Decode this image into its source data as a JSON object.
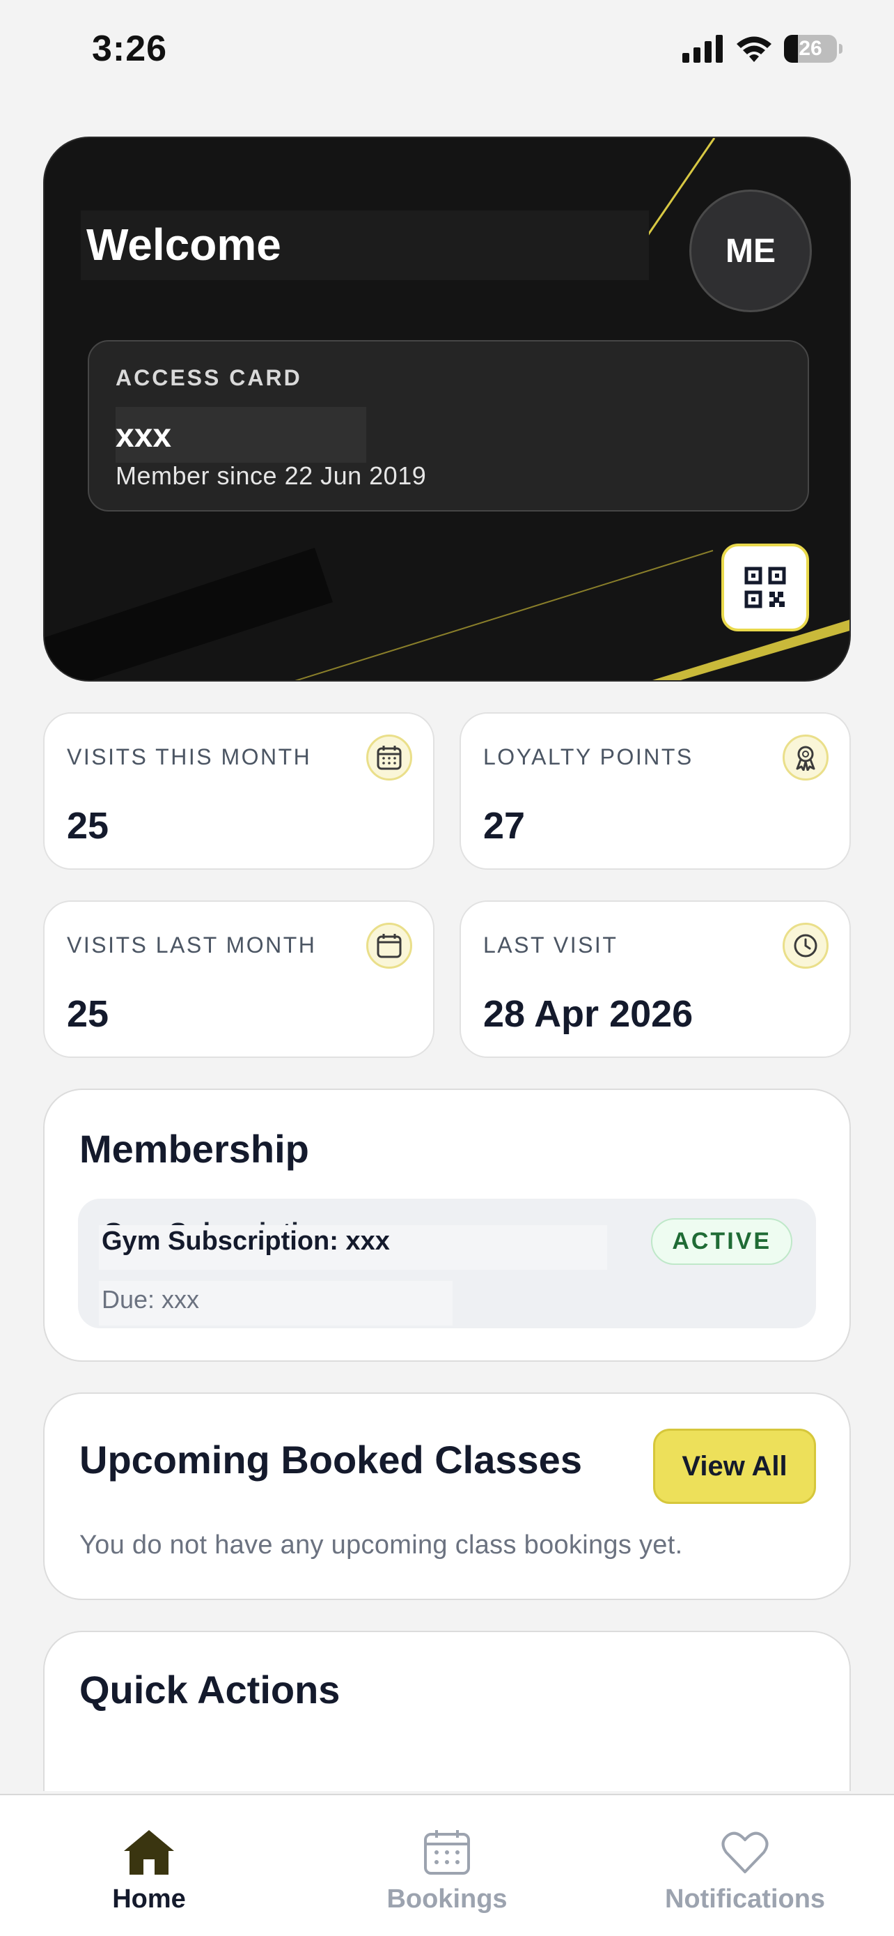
{
  "status_bar": {
    "time": "3:26",
    "battery": "26",
    "battery_level": 0.26
  },
  "hero": {
    "title": "Welcome",
    "avatar_initials": "ME",
    "access_card": {
      "label": "ACCESS CARD",
      "name": "xxx",
      "member_since": "Member since 22 Jun 2019"
    },
    "qr_icon": "qr-code-icon"
  },
  "stats": [
    {
      "label": "VISITS THIS MONTH",
      "value": "25",
      "icon": "calendar-grid-icon"
    },
    {
      "label": "LOYALTY POINTS",
      "value": "27",
      "icon": "award-ribbon-icon"
    },
    {
      "label": "VISITS LAST MONTH",
      "value": "25",
      "icon": "calendar-icon"
    },
    {
      "label": "LAST VISIT",
      "value": "28 Apr 2026",
      "icon": "clock-icon"
    }
  ],
  "membership": {
    "title": "Membership",
    "item": {
      "name": "Gym Subscription: xxx",
      "due": "Due: xxx",
      "status": "ACTIVE"
    }
  },
  "upcoming": {
    "title": "Upcoming Booked Classes",
    "view_all_label": "View All",
    "empty_message": "You do not have any upcoming class bookings yet."
  },
  "quick_actions": {
    "title": "Quick Actions"
  },
  "tabs": [
    {
      "label": "Home",
      "icon": "home-icon",
      "active": true
    },
    {
      "label": "Bookings",
      "icon": "calendar-icon",
      "active": false
    },
    {
      "label": "Notifications",
      "icon": "heart-icon",
      "active": false
    }
  ],
  "colors": {
    "accent": "#ede05a",
    "dark_card": "#141414",
    "active_badge": "#1f6b35"
  }
}
